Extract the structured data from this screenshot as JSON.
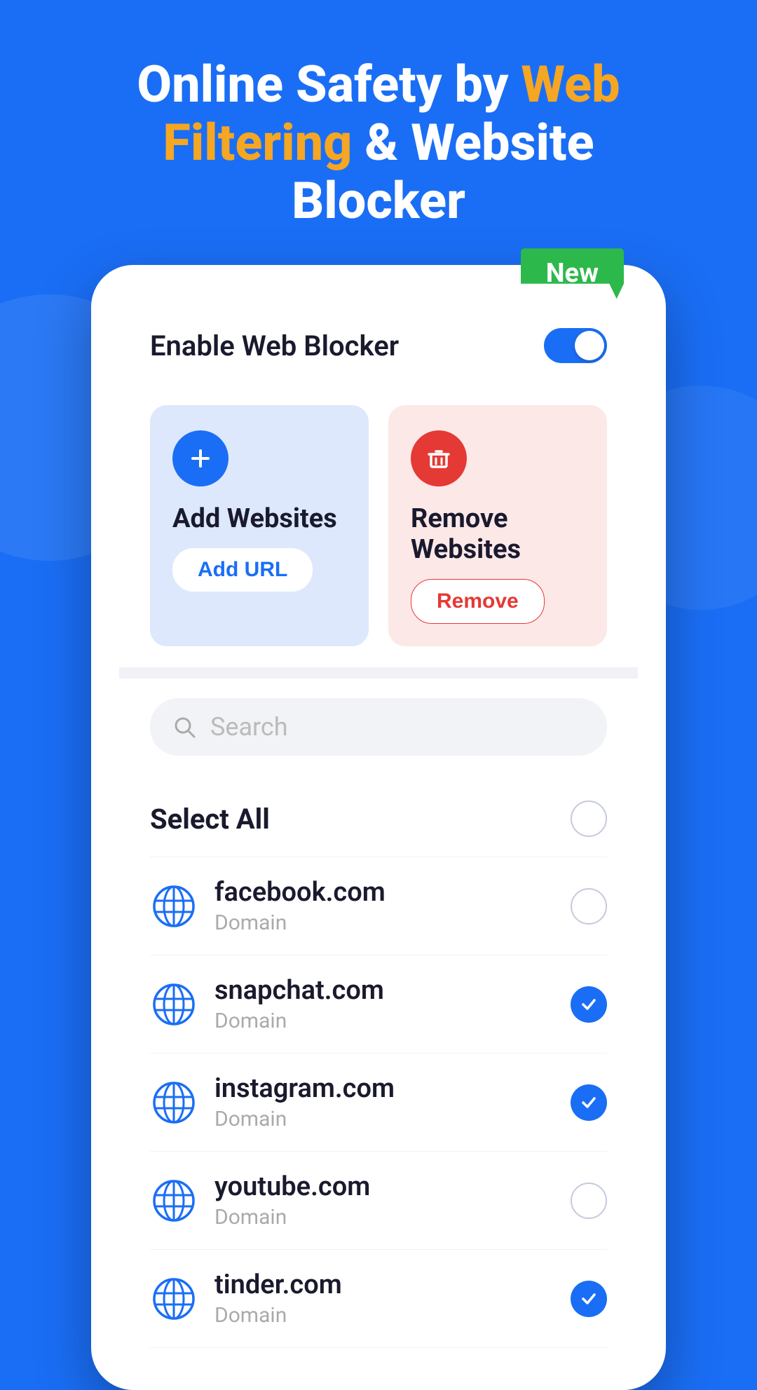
{
  "hero": {
    "line1": "Online Safety by ",
    "accent1": "Web",
    "line2": "Filtering",
    "line2b": " & Website",
    "line3": "Blocker"
  },
  "badge": {
    "label": "New"
  },
  "toggle_section": {
    "label": "Enable Web Blocker"
  },
  "add_card": {
    "title": "Add Websites",
    "btn_label": "Add URL"
  },
  "remove_card": {
    "title": "Remove Websites",
    "btn_label": "Remove"
  },
  "search": {
    "placeholder": "Search"
  },
  "select_all": {
    "label": "Select All"
  },
  "sites": [
    {
      "name": "facebook.com",
      "type": "Domain",
      "checked": false
    },
    {
      "name": "snapchat.com",
      "type": "Domain",
      "checked": true
    },
    {
      "name": "instagram.com",
      "type": "Domain",
      "checked": true
    },
    {
      "name": "youtube.com",
      "type": "Domain",
      "checked": false
    },
    {
      "name": "tinder.com",
      "type": "Domain",
      "checked": true
    }
  ],
  "colors": {
    "primary": "#1a6ef5",
    "accent": "#f5a623",
    "green": "#2db84b",
    "red": "#e53935"
  }
}
